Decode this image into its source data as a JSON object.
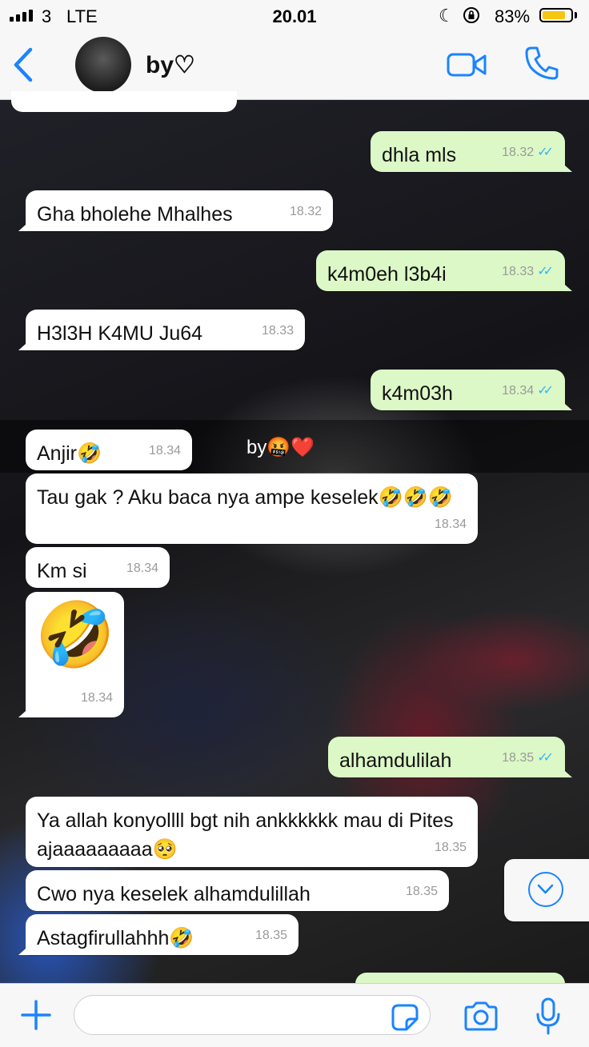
{
  "status_bar": {
    "carrier": "3",
    "network": "LTE",
    "time": "20.01",
    "battery_percent": "83%",
    "battery_level": 0.83,
    "icons": [
      "signal-bars-icon",
      "moon-icon",
      "rotation-lock-icon",
      "battery-icon"
    ]
  },
  "header": {
    "contact_name": "by♡",
    "icons": [
      "back-chevron-icon",
      "avatar",
      "video-call-icon",
      "phone-icon"
    ]
  },
  "wallpaper_caption": "by🤬❤️",
  "messages": [
    {
      "dir": "out",
      "text": "dhla mls",
      "time": "18.32",
      "read": true
    },
    {
      "dir": "in",
      "text": "Gha bholehe Mhalhes",
      "time": "18.32"
    },
    {
      "dir": "out",
      "text": "k4m0eh l3b4i",
      "time": "18.33",
      "read": true
    },
    {
      "dir": "in",
      "text": "H3l3H K4MU Ju64",
      "time": "18.33"
    },
    {
      "dir": "out",
      "text": "k4m03h",
      "time": "18.34",
      "read": true
    },
    {
      "dir": "in",
      "text": "Anjir🤣",
      "time": "18.34"
    },
    {
      "dir": "in",
      "text": "Tau gak ? Aku baca  nya ampe keselek🤣🤣🤣",
      "time": "18.34"
    },
    {
      "dir": "in",
      "text": "Km si",
      "time": "18.34"
    },
    {
      "dir": "in",
      "text": "🤣",
      "time": "18.34"
    },
    {
      "dir": "out",
      "text": "alhamdulilah",
      "time": "18.35",
      "read": true
    },
    {
      "dir": "in",
      "text": "Ya allah konyollll bgt nih ankkkkkk mau di Pites ajaaaaaaaaa🥺",
      "time": "18.35"
    },
    {
      "dir": "in",
      "text": "Cwo nya keselek alhamdulillah",
      "time": "18.35"
    },
    {
      "dir": "in",
      "text": "Astagfirullahhh🤣",
      "time": "18.35"
    }
  ],
  "read_ticks": "✓✓",
  "colors": {
    "accent": "#1a84ff",
    "outgoing_bubble": "#dcf8c6",
    "incoming_bubble": "#ffffff",
    "read_tick": "#34b7f1",
    "battery": "#f6c615"
  },
  "input_bar": {
    "placeholder": "",
    "icons": [
      "plus-icon",
      "sticker-icon",
      "camera-icon",
      "microphone-icon"
    ]
  }
}
